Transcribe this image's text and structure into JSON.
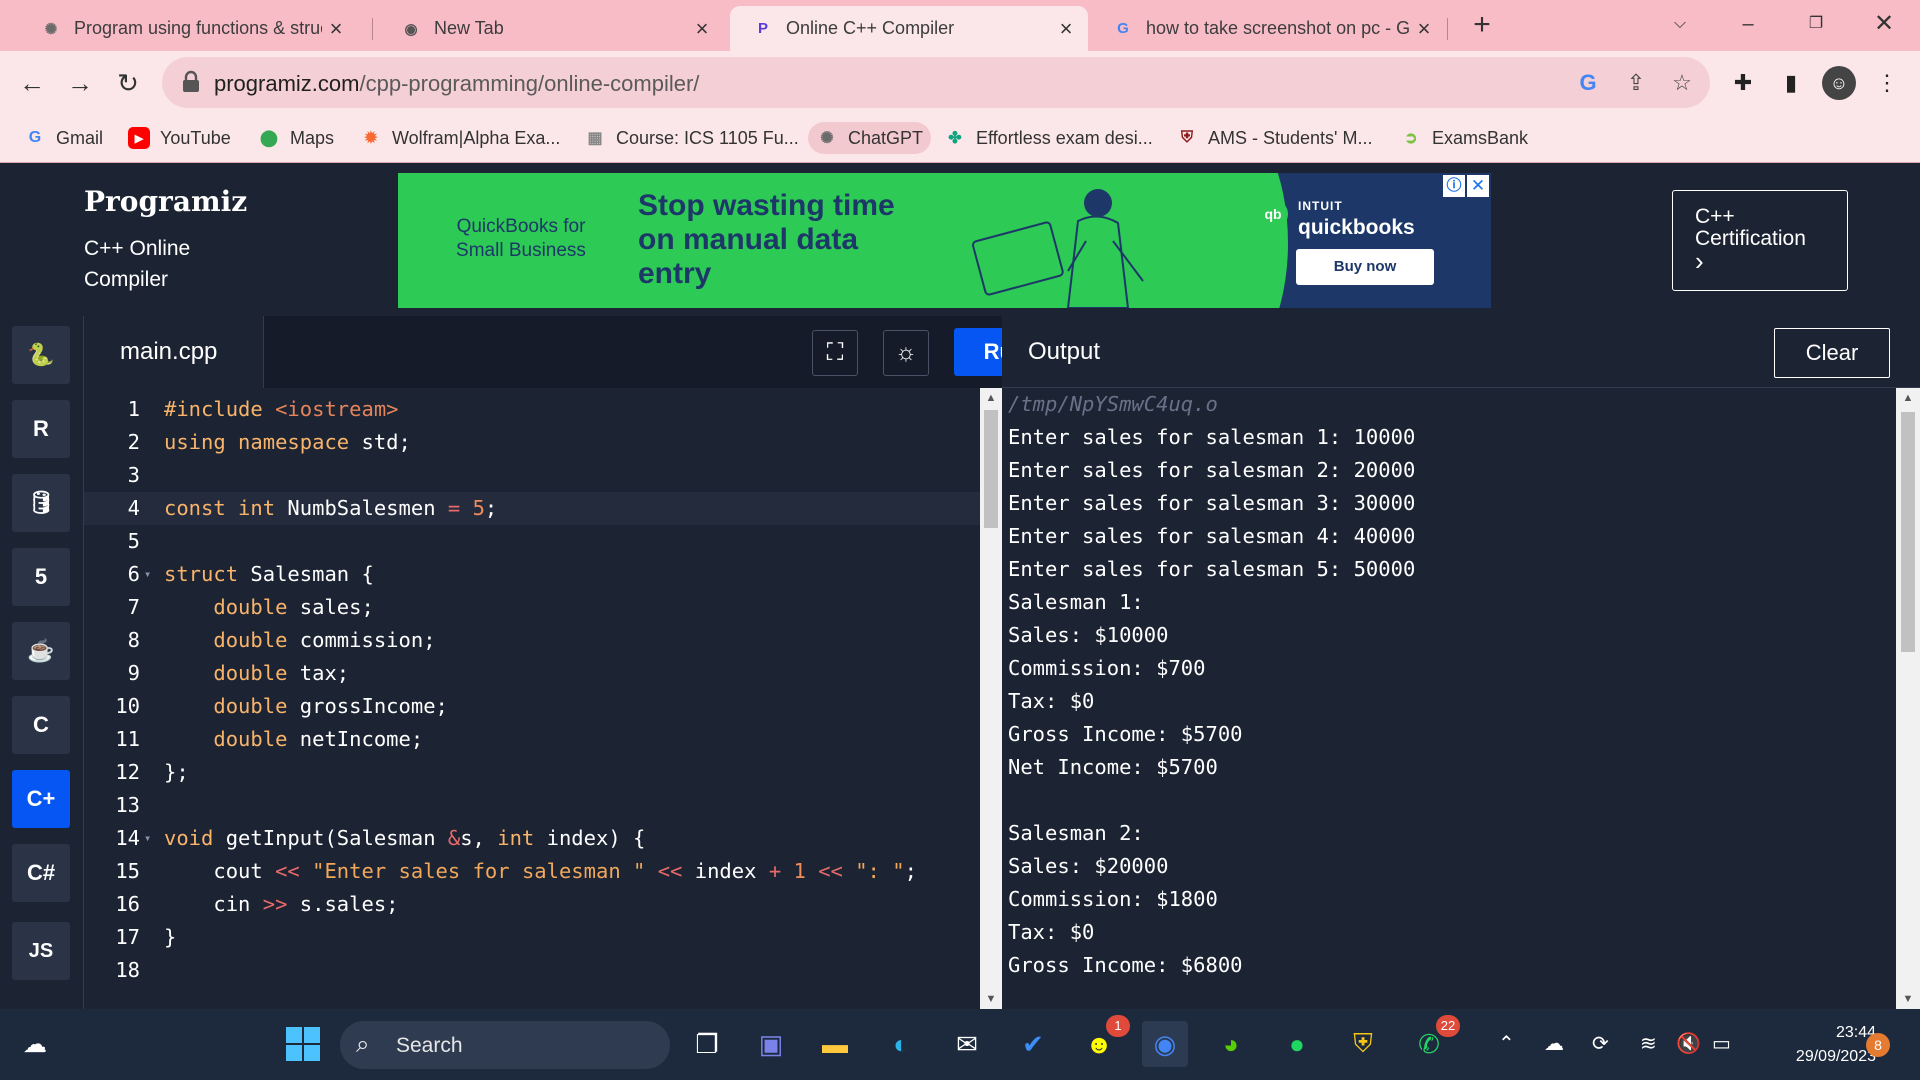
{
  "browser": {
    "tabs": [
      {
        "title": "Program using functions & struc",
        "active": false,
        "icon": "chatgpt-icon"
      },
      {
        "title": "New Tab",
        "active": false,
        "icon": "chrome-icon"
      },
      {
        "title": "Online C++ Compiler",
        "active": true,
        "icon": "programiz-icon"
      },
      {
        "title": "how to take screenshot on pc - G",
        "active": false,
        "icon": "google-icon"
      }
    ],
    "new_tab": "+",
    "url_host": "programiz.com",
    "url_path": "/cpp-programming/online-compiler/",
    "bookmarks": [
      {
        "label": "Gmail",
        "icon": "google-icon",
        "color": "#4285f4"
      },
      {
        "label": "YouTube",
        "icon": "youtube-icon",
        "color": "#ff0000"
      },
      {
        "label": "Maps",
        "icon": "maps-icon",
        "color": "#34a853"
      },
      {
        "label": "Wolfram|Alpha Exa...",
        "icon": "wolfram-icon",
        "color": "#f96932"
      },
      {
        "label": "Course: ICS 1105 Fu...",
        "icon": "moodle-icon",
        "color": "#888888"
      },
      {
        "label": "ChatGPT",
        "icon": "chatgpt-icon",
        "color": "#6b6b6b"
      },
      {
        "label": "Effortless exam desi...",
        "icon": "exam-icon",
        "color": "#10a37f"
      },
      {
        "label": "AMS - Students' M...",
        "icon": "ams-icon",
        "color": "#8b1a1a"
      },
      {
        "label": "ExamsBank",
        "icon": "examsbank-icon",
        "color": "#7bc142"
      }
    ]
  },
  "site": {
    "logo": "Programiz",
    "subtitle": "C++ Online Compiler",
    "ad": {
      "qb_text": "QuickBooks for Small Business",
      "headline": "Stop wasting time on manual data entry",
      "brand_top": "INTUIT",
      "brand": "quickbooks",
      "brand_mark": "qb",
      "cta": "Buy now"
    },
    "certification": {
      "line1": "C++",
      "line2": "Certification",
      "arrow": "›"
    }
  },
  "rail": [
    {
      "name": "python-lang-icon",
      "glyph": "🐍",
      "active": false
    },
    {
      "name": "r-lang-icon",
      "glyph": "R",
      "active": false
    },
    {
      "name": "sql-lang-icon",
      "glyph": "🛢",
      "active": false
    },
    {
      "name": "html-lang-icon",
      "glyph": "5",
      "active": false
    },
    {
      "name": "java-lang-icon",
      "glyph": "☕",
      "active": false
    },
    {
      "name": "c-lang-icon",
      "glyph": "C",
      "active": false
    },
    {
      "name": "cpp-lang-icon",
      "glyph": "C+",
      "active": true
    },
    {
      "name": "csharp-lang-icon",
      "glyph": "C#",
      "active": false
    },
    {
      "name": "js-lang-icon",
      "glyph": "JS",
      "active": false
    }
  ],
  "editor": {
    "filename": "main.cpp",
    "run_label": "Run",
    "code": [
      {
        "n": "1",
        "fold": false,
        "cur": false,
        "parts": [
          {
            "t": "#include ",
            "c": "kw"
          },
          {
            "t": "<iostream>",
            "c": "hdr"
          }
        ]
      },
      {
        "n": "2",
        "fold": false,
        "cur": false,
        "parts": [
          {
            "t": "using namespace",
            "c": "kw"
          },
          {
            "t": " std;",
            "c": ""
          }
        ]
      },
      {
        "n": "3",
        "fold": false,
        "cur": false,
        "parts": []
      },
      {
        "n": "4",
        "fold": false,
        "cur": true,
        "parts": [
          {
            "t": "const int",
            "c": "kw"
          },
          {
            "t": " NumbSalesmen ",
            "c": ""
          },
          {
            "t": "=",
            "c": "op"
          },
          {
            "t": " ",
            "c": ""
          },
          {
            "t": "5",
            "c": "num"
          },
          {
            "t": ";",
            "c": ""
          }
        ]
      },
      {
        "n": "5",
        "fold": false,
        "cur": false,
        "parts": []
      },
      {
        "n": "6",
        "fold": true,
        "cur": false,
        "parts": [
          {
            "t": "struct",
            "c": "kw"
          },
          {
            "t": " Salesman {",
            "c": ""
          }
        ]
      },
      {
        "n": "7",
        "fold": false,
        "cur": false,
        "parts": [
          {
            "t": "    ",
            "c": ""
          },
          {
            "t": "double",
            "c": "kw"
          },
          {
            "t": " sales;",
            "c": ""
          }
        ]
      },
      {
        "n": "8",
        "fold": false,
        "cur": false,
        "parts": [
          {
            "t": "    ",
            "c": ""
          },
          {
            "t": "double",
            "c": "kw"
          },
          {
            "t": " commission;",
            "c": ""
          }
        ]
      },
      {
        "n": "9",
        "fold": false,
        "cur": false,
        "parts": [
          {
            "t": "    ",
            "c": ""
          },
          {
            "t": "double",
            "c": "kw"
          },
          {
            "t": " tax;",
            "c": ""
          }
        ]
      },
      {
        "n": "10",
        "fold": false,
        "cur": false,
        "parts": [
          {
            "t": "    ",
            "c": ""
          },
          {
            "t": "double",
            "c": "kw"
          },
          {
            "t": " grossIncome;",
            "c": ""
          }
        ]
      },
      {
        "n": "11",
        "fold": false,
        "cur": false,
        "parts": [
          {
            "t": "    ",
            "c": ""
          },
          {
            "t": "double",
            "c": "kw"
          },
          {
            "t": " netIncome;",
            "c": ""
          }
        ]
      },
      {
        "n": "12",
        "fold": false,
        "cur": false,
        "parts": [
          {
            "t": "};",
            "c": ""
          }
        ]
      },
      {
        "n": "13",
        "fold": false,
        "cur": false,
        "parts": []
      },
      {
        "n": "14",
        "fold": true,
        "cur": false,
        "parts": [
          {
            "t": "void",
            "c": "kw"
          },
          {
            "t": " getInput(Salesman ",
            "c": ""
          },
          {
            "t": "&",
            "c": "op"
          },
          {
            "t": "s, ",
            "c": ""
          },
          {
            "t": "int",
            "c": "kw"
          },
          {
            "t": " index) {",
            "c": ""
          }
        ]
      },
      {
        "n": "15",
        "fold": false,
        "cur": false,
        "parts": [
          {
            "t": "    cout ",
            "c": ""
          },
          {
            "t": "<<",
            "c": "op"
          },
          {
            "t": " ",
            "c": ""
          },
          {
            "t": "\"Enter sales for salesman \"",
            "c": "str"
          },
          {
            "t": " ",
            "c": ""
          },
          {
            "t": "<<",
            "c": "op"
          },
          {
            "t": " index ",
            "c": ""
          },
          {
            "t": "+",
            "c": "op"
          },
          {
            "t": " ",
            "c": ""
          },
          {
            "t": "1",
            "c": "num"
          },
          {
            "t": " ",
            "c": ""
          },
          {
            "t": "<<",
            "c": "op"
          },
          {
            "t": " ",
            "c": ""
          },
          {
            "t": "\": \"",
            "c": "str"
          },
          {
            "t": ";",
            "c": ""
          }
        ]
      },
      {
        "n": "16",
        "fold": false,
        "cur": false,
        "parts": [
          {
            "t": "    cin ",
            "c": ""
          },
          {
            "t": ">>",
            "c": "op"
          },
          {
            "t": " s.sales;",
            "c": ""
          }
        ]
      },
      {
        "n": "17",
        "fold": false,
        "cur": false,
        "parts": [
          {
            "t": "}",
            "c": ""
          }
        ]
      },
      {
        "n": "18",
        "fold": false,
        "cur": false,
        "parts": []
      }
    ]
  },
  "output": {
    "title": "Output",
    "clear_label": "Clear",
    "lines": [
      "/tmp/NpYSmwC4uq.o",
      "Enter sales for salesman 1: 10000",
      "Enter sales for salesman 2: 20000",
      "Enter sales for salesman 3: 30000",
      "Enter sales for salesman 4: 40000",
      "Enter sales for salesman 5: 50000",
      "Salesman 1:",
      "Sales: $10000",
      "Commission: $700",
      "Tax: $0",
      "Gross Income: $5700",
      "Net Income: $5700",
      "",
      "Salesman 2:",
      "Sales: $20000",
      "Commission: $1800",
      "Tax: $0",
      "Gross Income: $6800"
    ]
  },
  "taskbar": {
    "search_label": "Search",
    "time": "23:44",
    "date": "29/09/2023",
    "notifications": "8",
    "badges": {
      "snapchat": "1",
      "whatsapp": "22"
    }
  }
}
